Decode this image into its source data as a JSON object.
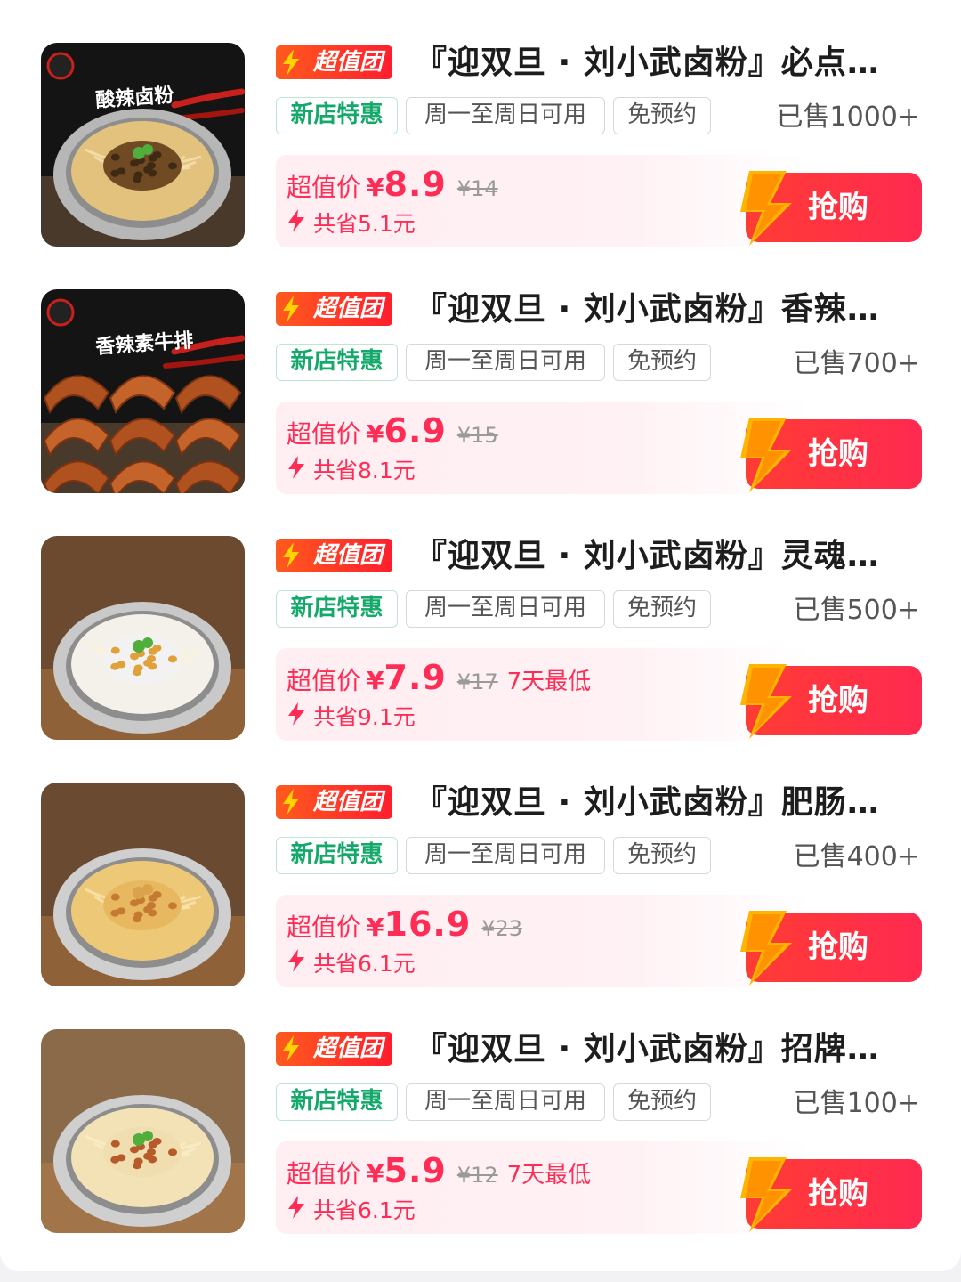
{
  "deals": [
    {
      "badge": "超值团",
      "title": "『迎双旦 · 刘小武卤粉』必点…",
      "tags": [
        "新店特惠",
        "周一至周日可用",
        "免预约"
      ],
      "sold": "已售1000+",
      "price_label": "超值价",
      "currency": "¥",
      "price": "8.9",
      "original_price": "¥14",
      "lowest_tag": "",
      "saving": "共省5.1元",
      "buy_label": "抢购",
      "image": "酸辣卤粉"
    },
    {
      "badge": "超值团",
      "title": "『迎双旦 · 刘小武卤粉』香辣…",
      "tags": [
        "新店特惠",
        "周一至周日可用",
        "免预约"
      ],
      "sold": "已售700+",
      "price_label": "超值价",
      "currency": "¥",
      "price": "6.9",
      "original_price": "¥15",
      "lowest_tag": "",
      "saving": "共省8.1元",
      "buy_label": "抢购",
      "image": "香辣素牛排"
    },
    {
      "badge": "超值团",
      "title": "『迎双旦 · 刘小武卤粉』灵魂…",
      "tags": [
        "新店特惠",
        "周一至周日可用",
        "免预约"
      ],
      "sold": "已售500+",
      "price_label": "超值价",
      "currency": "¥",
      "price": "7.9",
      "original_price": "¥17",
      "lowest_tag": "7天最低",
      "saving": "共省9.1元",
      "buy_label": "抢购",
      "image": ""
    },
    {
      "badge": "超值团",
      "title": "『迎双旦 · 刘小武卤粉』肥肠…",
      "tags": [
        "新店特惠",
        "周一至周日可用",
        "免预约"
      ],
      "sold": "已售400+",
      "price_label": "超值价",
      "currency": "¥",
      "price": "16.9",
      "original_price": "¥23",
      "lowest_tag": "",
      "saving": "共省6.1元",
      "buy_label": "抢购",
      "image": ""
    },
    {
      "badge": "超值团",
      "title": "『迎双旦 · 刘小武卤粉』招牌…",
      "tags": [
        "新店特惠",
        "周一至周日可用",
        "免预约"
      ],
      "sold": "已售100+",
      "price_label": "超值价",
      "currency": "¥",
      "price": "5.9",
      "original_price": "¥12",
      "lowest_tag": "7天最低",
      "saving": "共省6.1元",
      "buy_label": "抢购",
      "image": ""
    }
  ],
  "colors": {
    "accent": "#ff2d55",
    "badge_orange": "#ff5a1e",
    "tag_green": "#14a96a",
    "button_red": "#ff3c34"
  }
}
